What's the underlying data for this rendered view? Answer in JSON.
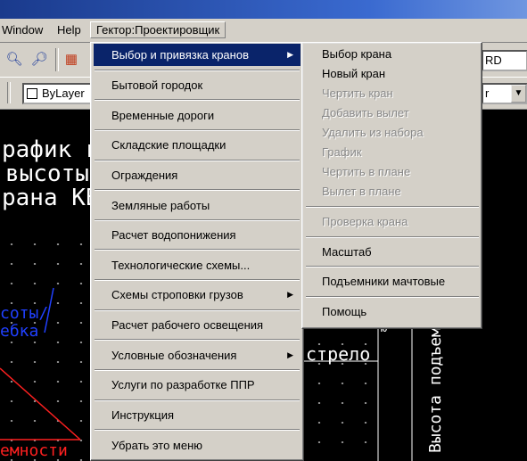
{
  "menubar": {
    "window": "Window",
    "help": "Help",
    "gektor": "Гектор:Проектировщик"
  },
  "toolbar": {
    "layer_value": "ByLayer",
    "combo_right_1": "RD",
    "combo_right_2": "r"
  },
  "drawing": {
    "title_line1": "рафик г",
    "title_line2": "высоты",
    "title_line3": "рана КБ",
    "label_blue1": "соты/",
    "label_blue2": "ебка",
    "label_red": "емности",
    "label_strelo": "стрело",
    "label_vertical": "Высота подъем",
    "label_small": "Ю"
  },
  "menu": {
    "items": [
      {
        "label": "Выбор и привязка кранов",
        "submenu": true,
        "selected": true
      },
      {
        "label": "Бытовой городок",
        "submenu": false
      },
      {
        "label": "Временные дороги",
        "submenu": false
      },
      {
        "label": "Складские площадки",
        "submenu": false
      },
      {
        "label": "Ограждения",
        "submenu": false
      },
      {
        "label": "Земляные работы",
        "submenu": false
      },
      {
        "label": "Расчет водопонижения",
        "submenu": false
      },
      {
        "label": "Технологические схемы...",
        "submenu": false
      },
      {
        "label": "Схемы строповки грузов",
        "submenu": true
      },
      {
        "label": "Расчет рабочего освещения",
        "submenu": false
      },
      {
        "label": "Условные обозначения",
        "submenu": true
      },
      {
        "label": "Услуги по разработке ППР",
        "submenu": false
      },
      {
        "label": "Инструкция",
        "submenu": false
      },
      {
        "label": "Убрать это меню",
        "submenu": false
      }
    ],
    "arrow_glyph": "▶"
  },
  "submenu": {
    "items": [
      {
        "label": "Выбор крана",
        "enabled": true
      },
      {
        "label": "Новый кран",
        "enabled": true
      },
      {
        "label": "Чертить кран",
        "enabled": false
      },
      {
        "label": "Добавить вылет",
        "enabled": false
      },
      {
        "label": "Удалить из набора",
        "enabled": false
      },
      {
        "label": "График",
        "enabled": false
      },
      {
        "label": "Чертить в плане",
        "enabled": false
      },
      {
        "label": "Вылет в плане",
        "enabled": false
      },
      {
        "label": "Проверка крана",
        "enabled": false
      },
      {
        "label": "Масштаб",
        "enabled": true
      },
      {
        "label": "Подъемники мачтовые",
        "enabled": true
      },
      {
        "label": "Помощь",
        "enabled": true
      }
    ]
  },
  "colors": {
    "menu_bg": "#d4d0c8",
    "highlight": "#0a246a",
    "disabled": "#888888",
    "cad_bg": "#000000"
  }
}
